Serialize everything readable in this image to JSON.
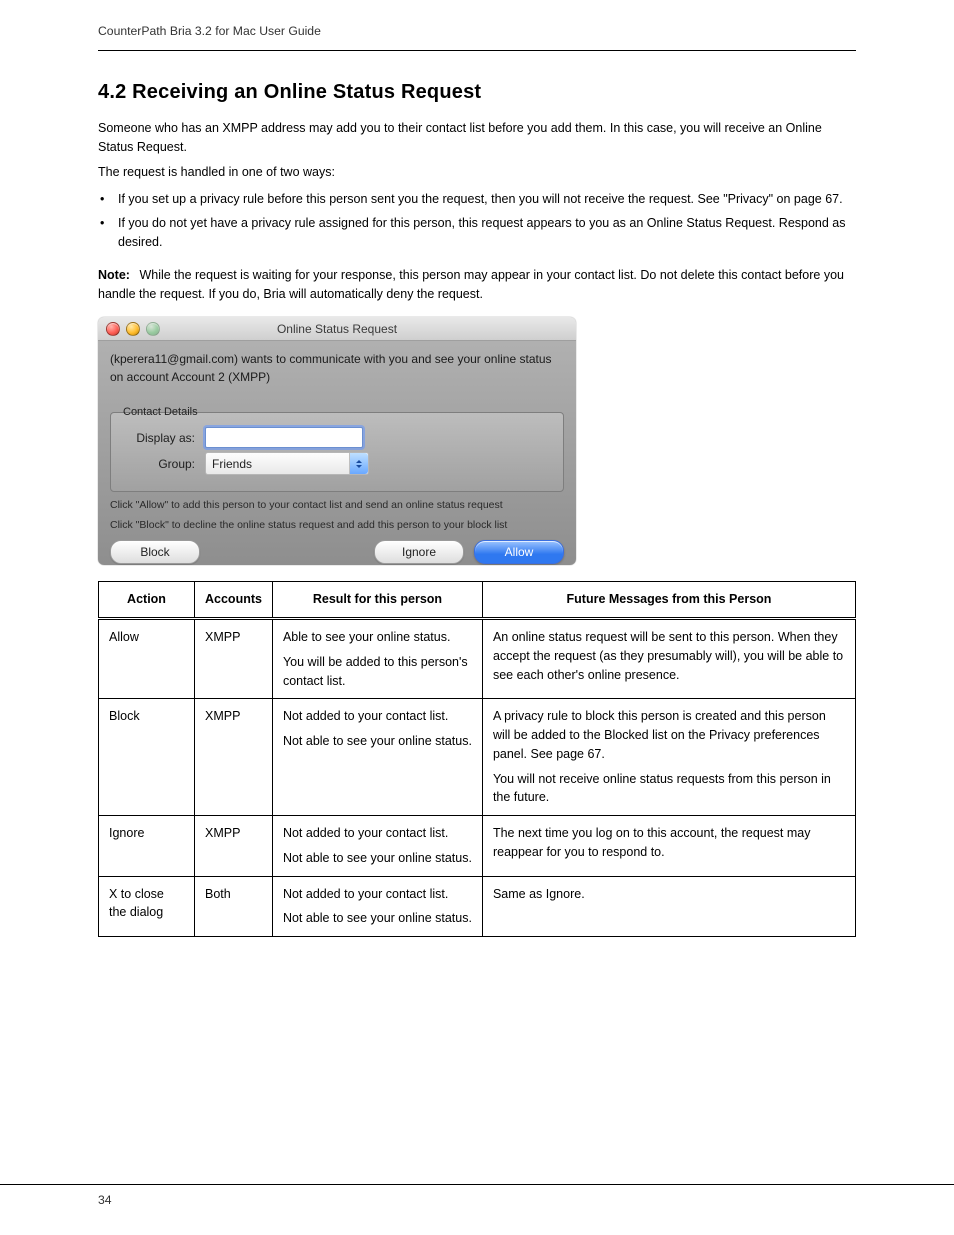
{
  "header": {
    "left": "CounterPath Bria 3.2 for Mac User Guide",
    "right": ""
  },
  "section": {
    "title": "4.2 Receiving an Online Status Request",
    "p1": "Someone who has an XMPP address may add you to their contact list before you add them. In this case, you will receive an Online Status Request.",
    "p2_intro": "The request is handled in one of two ways:",
    "bullets": [
      "If you set up a privacy rule before this person sent you the request, then you will not receive the request. See \"Privacy\" on page 67.",
      "If you do not yet have a privacy rule assigned for this person, this request appears to you as an Online Status Request. Respond as desired."
    ],
    "note_label": "Note:",
    "note_text": "While the request is waiting for your response, this person may appear in your contact list. Do not delete this contact before you handle the request. If you do, Bria will automatically deny the request."
  },
  "dialog": {
    "title": "Online Status Request",
    "message": "(kperera11@gmail.com) wants to communicate with you and see your online status on account  Account 2 (XMPP)",
    "fieldset_title": "Contact Details",
    "display_as_label": "Display as:",
    "group_label": "Group:",
    "group_value": "Friends",
    "hint1": "Click \"Allow\" to add this person to your contact list and send an online status request",
    "hint2": "Click \"Block\" to decline the online status request and add this person to your block list",
    "buttons": {
      "block": "Block",
      "ignore": "Ignore",
      "allow": "Allow"
    }
  },
  "table": {
    "headers": [
      "Action",
      "Accounts",
      "Result for this person",
      "Future Messages from this Person"
    ],
    "rows": [
      {
        "action": "Allow",
        "accounts": "XMPP",
        "result": "Able to see your online status.\n\nYou will be added to this person's contact list.",
        "future": "An online status request will be sent to this person. When they accept the request (as they presumably will), you will be able to see each other's online presence."
      },
      {
        "action": "Block",
        "accounts": "XMPP",
        "result": "Not added to your contact list.\n\nNot able to see your online status.",
        "future": "A privacy rule to block this person is created and this person will be added to the Blocked list on the Privacy preferences panel. See page 67.\n\nYou will not receive online status requests from this person in the future."
      },
      {
        "action": "Ignore",
        "accounts": "XMPP",
        "result": "Not added to your contact list.\n\nNot able to see your online status.",
        "future": "The next time you log on to this account, the request may reappear for you to respond to."
      },
      {
        "action": "X to close the dialog",
        "accounts": "Both",
        "result": "Not added to your contact list.\n\nNot able to see your online status.",
        "future": "Same as Ignore."
      }
    ]
  },
  "footer": {
    "left": "34",
    "right": ""
  }
}
